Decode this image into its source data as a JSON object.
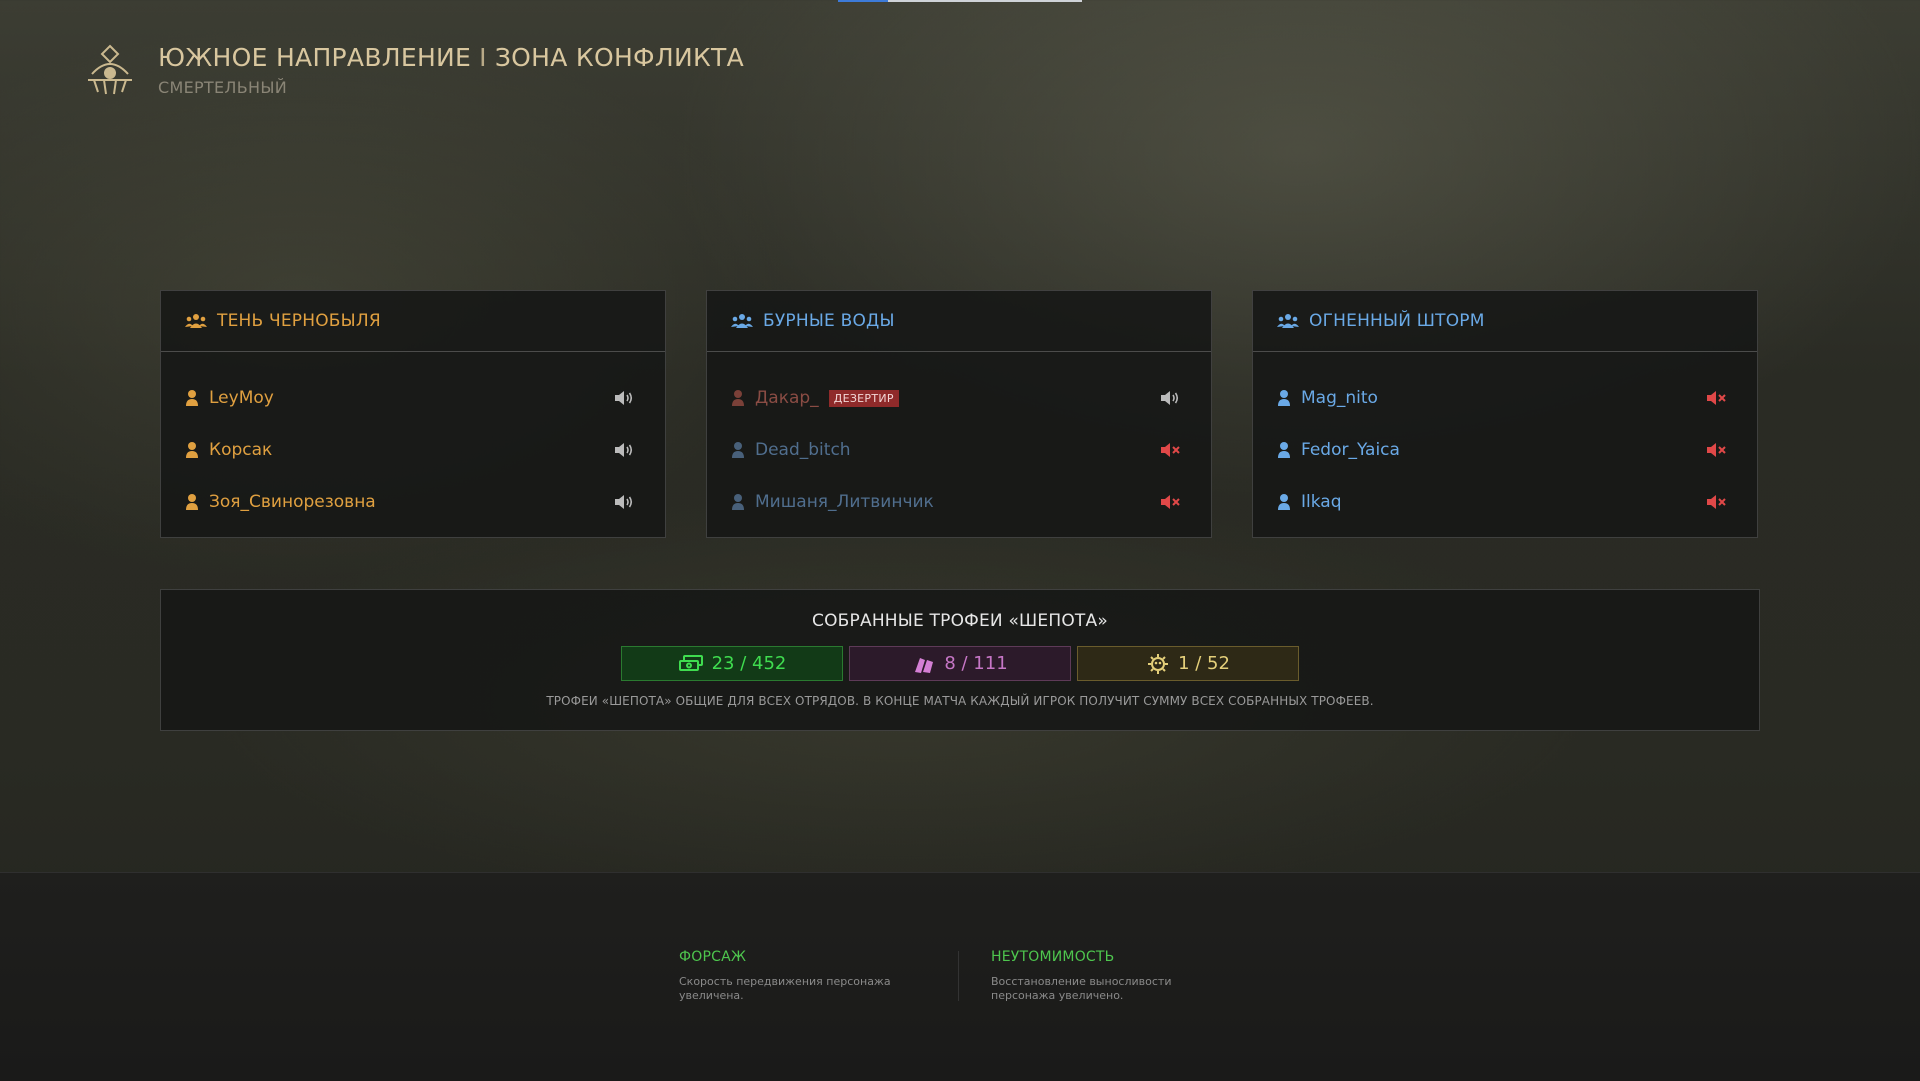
{
  "header": {
    "title_left": "ЮЖНОЕ НАПРАВЛЕНИЕ",
    "separator": "I",
    "title_right": "ЗОНА КОНФЛИКТА",
    "difficulty": "СМЕРТЕЛЬНЫЙ"
  },
  "squads": [
    {
      "name": "ТЕНЬ ЧЕРНОБЫЛЯ",
      "color": "#e0a040",
      "players": [
        {
          "name": "LeyMoy",
          "status": "",
          "voice": "on"
        },
        {
          "name": "Корсак",
          "status": "",
          "voice": "on"
        },
        {
          "name": "Зоя_Свинорезовна",
          "status": "",
          "voice": "on"
        }
      ]
    },
    {
      "name": "БУРНЫЕ ВОДЫ",
      "color": "#6aa9e6",
      "players": [
        {
          "name": "Дакар_",
          "status": "ДЕЗЕРТИР",
          "voice": "on"
        },
        {
          "name": "Dead_bitch",
          "status": "",
          "voice": "muted"
        },
        {
          "name": "Мишаня_Литвинчик",
          "status": "",
          "voice": "muted"
        }
      ]
    },
    {
      "name": "ОГНЕННЫЙ ШТОРМ",
      "color": "#6aa9e6",
      "players": [
        {
          "name": "Mag_nito",
          "status": "",
          "voice": "muted"
        },
        {
          "name": "Fedor_Yaica",
          "status": "",
          "voice": "muted"
        },
        {
          "name": "Ilkaq",
          "status": "",
          "voice": "muted"
        }
      ]
    }
  ],
  "trophies": {
    "title": "СОБРАННЫЕ ТРОФЕИ «ШЕПОТА»",
    "counters": [
      {
        "icon": "cash-stack-icon",
        "value": "23 / 452",
        "color": "#3fdc4f"
      },
      {
        "icon": "paint-cans-icon",
        "value": "8 / 111",
        "color": "#c676c6"
      },
      {
        "icon": "gear-skull-icon",
        "value": "1 / 52",
        "color": "#e4cf7a"
      }
    ],
    "note": "ТРОФЕИ «ШЕПОТА» ОБЩИЕ ДЛЯ ВСЕХ ОТРЯДОВ. В КОНЦЕ МАТЧА КАЖДЫЙ ИГРОК ПОЛУЧИТ СУММУ ВСЕХ СОБРАННЫХ ТРОФЕЕВ."
  },
  "perks": [
    {
      "title": "ФОРСАЖ",
      "desc": "Скорость передвижения персонажа увеличена."
    },
    {
      "title": "НЕУТОМИМОСТЬ",
      "desc": "Восстановление выносливости персонажа увеличено."
    }
  ]
}
